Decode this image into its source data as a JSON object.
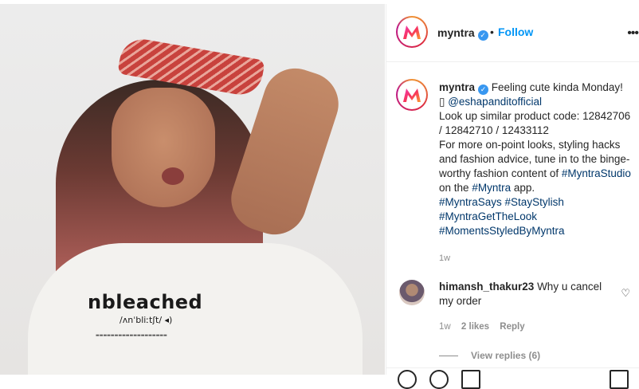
{
  "post": {
    "username": "myntra",
    "follow_label": "Follow",
    "separator": "•",
    "more_label": "•••"
  },
  "caption": {
    "username": "myntra",
    "text_intro": "Feeling cute kinda Monday!",
    "glyph": "▯",
    "mention": "@eshapanditofficial",
    "text_codes": "Look up similar product code: 12842706 / 12842710 / 12433112",
    "text_body": "For more on-point looks, styling hacks and fashion advice, tune in to the binge-worthy fashion content of",
    "hashtag_studio": "#MyntraStudio",
    "text_on": "on the",
    "hashtag_myntra": "#Myntra",
    "text_app": "app.",
    "hashtags": [
      "#MyntraSays",
      "#StayStylish",
      "#MyntraGetTheLook",
      "#MomentsStyledByMyntra"
    ],
    "time": "1w"
  },
  "comment": {
    "username": "himansh_thakur23",
    "text": "Why u cancel my order",
    "time": "1w",
    "likes": "2 likes",
    "reply_label": "Reply",
    "view_replies": "View replies (6)"
  },
  "photo": {
    "shirt_word": "nbleached",
    "shirt_phonetic": "/ʌnˈbliːtʃt/ ◂)"
  },
  "colors": {
    "accent": "#0095f6",
    "link": "#00376b",
    "verified": "#3897f0",
    "muted": "#8e8e8e"
  }
}
